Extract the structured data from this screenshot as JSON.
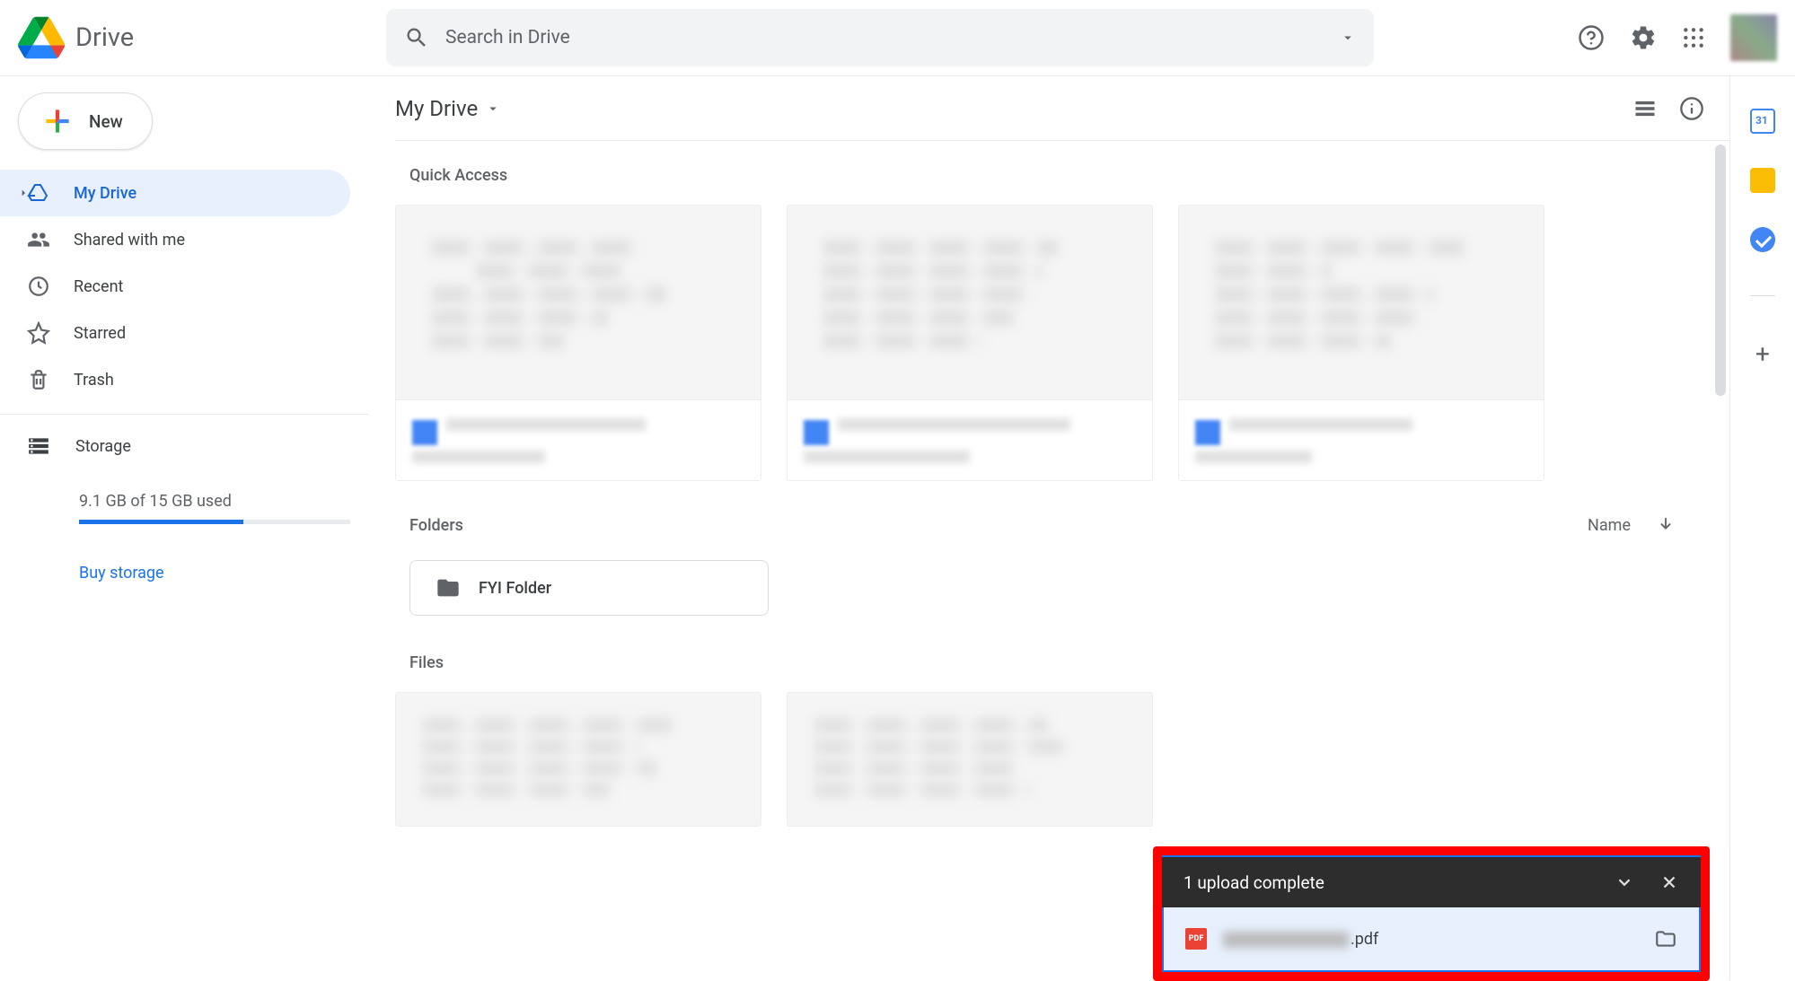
{
  "header": {
    "app_name": "Drive",
    "search_placeholder": "Search in Drive"
  },
  "sidebar": {
    "new_label": "New",
    "items": [
      {
        "label": "My Drive"
      },
      {
        "label": "Shared with me"
      },
      {
        "label": "Recent"
      },
      {
        "label": "Starred"
      },
      {
        "label": "Trash"
      }
    ],
    "storage_label": "Storage",
    "storage_used_text": "9.1 GB of 15 GB used",
    "storage_fraction": 0.607,
    "buy_label": "Buy storage"
  },
  "main": {
    "breadcrumb": "My Drive",
    "quick_access_label": "Quick Access",
    "folders_label": "Folders",
    "sort_label": "Name",
    "folder_items": [
      {
        "name": "FYI Folder"
      }
    ],
    "files_label": "Files"
  },
  "upload": {
    "title": "1 upload complete",
    "file_ext": ".pdf",
    "pdf_badge": "PDF"
  },
  "right_panel": {
    "calendar_day": "31"
  }
}
